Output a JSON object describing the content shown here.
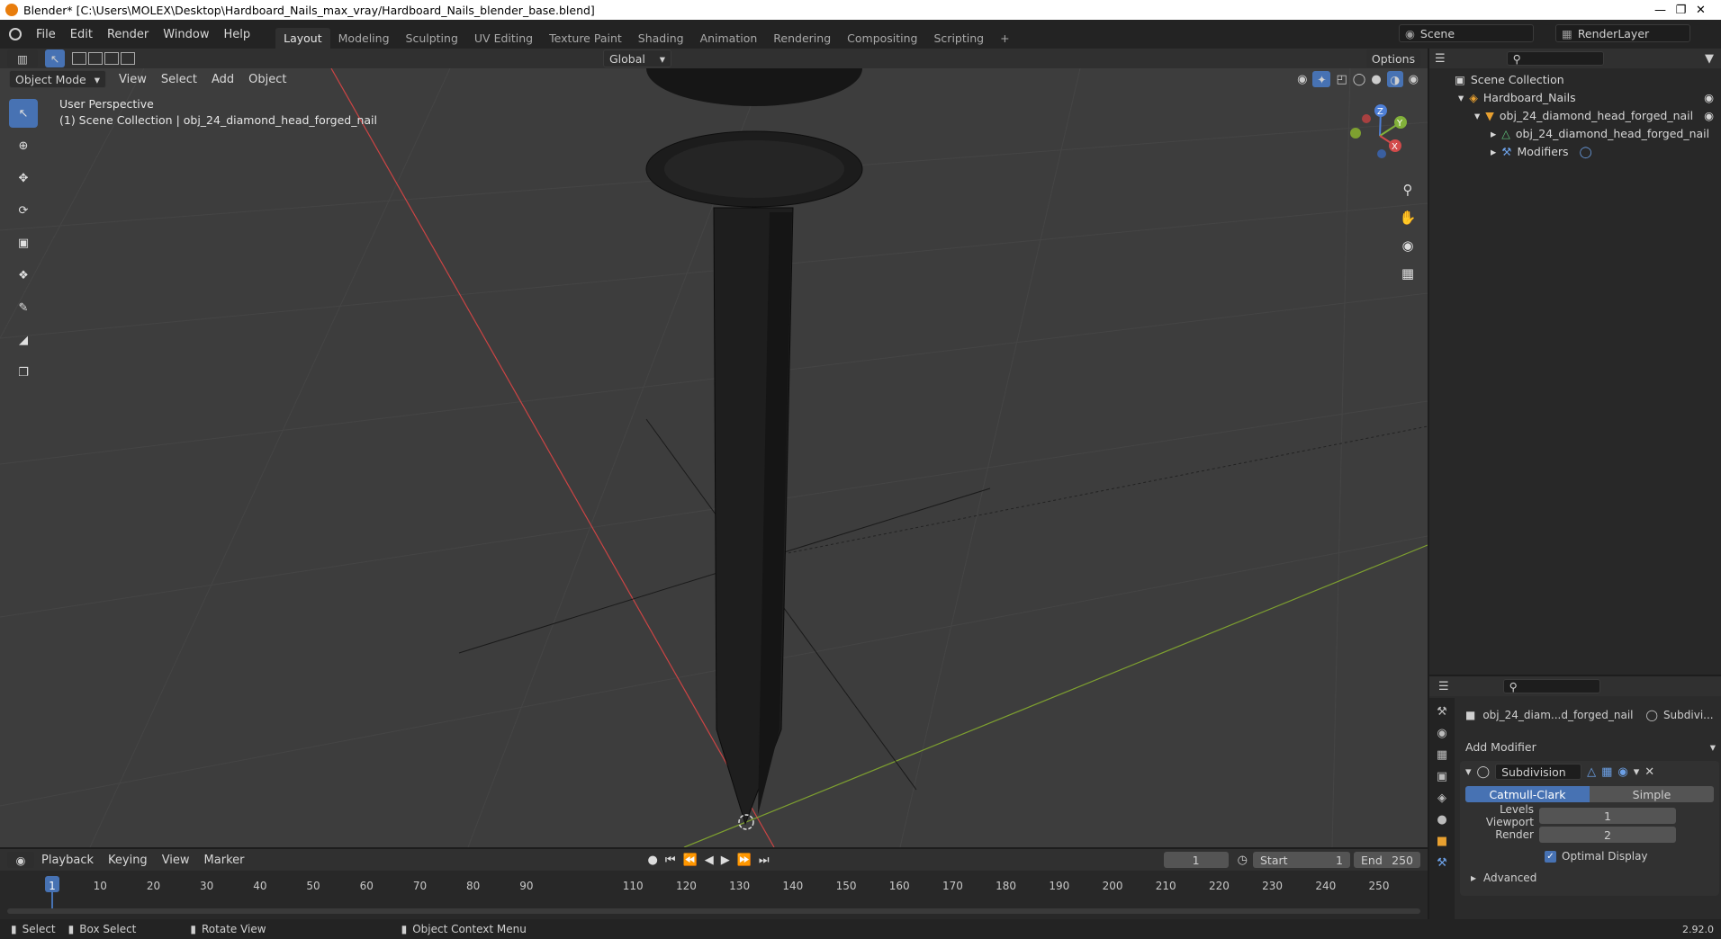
{
  "title": "Blender* [C:\\Users\\MOLEX\\Desktop\\Hardboard_Nails_max_vray/Hardboard_Nails_blender_base.blend]",
  "menus": [
    "File",
    "Edit",
    "Render",
    "Window",
    "Help"
  ],
  "workspaces": [
    "Layout",
    "Modeling",
    "Sculpting",
    "UV Editing",
    "Texture Paint",
    "Shading",
    "Animation",
    "Rendering",
    "Compositing",
    "Scripting"
  ],
  "scene": "Scene",
  "render_layer": "RenderLayer",
  "viewport": {
    "mode": "Object Mode",
    "menus": [
      "View",
      "Select",
      "Add",
      "Object"
    ],
    "transform": "Global",
    "options": "Options",
    "perspective": "User Perspective",
    "collection_info": "(1) Scene Collection | obj_24_diamond_head_forged_nail",
    "gizmo": {
      "z": "Z",
      "y": "Y",
      "x": "X"
    }
  },
  "outliner": {
    "root": "Scene Collection",
    "collection": "Hardboard_Nails",
    "object": "obj_24_diamond_head_forged_nail",
    "mesh": "obj_24_diamond_head_forged_nail",
    "modifiers": "Modifiers"
  },
  "properties": {
    "object": "obj_24_diam...d_forged_nail",
    "modifier_tab": "Subdivi...",
    "add_modifier": "Add Modifier",
    "modifier_name": "Subdivision",
    "algo_a": "Catmull-Clark",
    "algo_b": "Simple",
    "levels_label": "Levels Viewport",
    "levels_value": "1",
    "render_label": "Render",
    "render_value": "2",
    "optimal": "Optimal Display",
    "advanced": "Advanced"
  },
  "timeline": {
    "menus": [
      "Playback",
      "Keying",
      "View",
      "Marker"
    ],
    "current_frame": "1",
    "start_label": "Start",
    "start": "1",
    "end_label": "End",
    "end": "250",
    "ticks": [
      "1",
      "10",
      "20",
      "30",
      "40",
      "50",
      "60",
      "70",
      "80",
      "90",
      "110",
      "120",
      "130",
      "140",
      "150",
      "160",
      "170",
      "180",
      "190",
      "200",
      "210",
      "220",
      "230",
      "240",
      "250"
    ]
  },
  "status": {
    "select": "Select",
    "box_select": "Box Select",
    "rotate": "Rotate View",
    "context": "Object Context Menu",
    "version": "2.92.0"
  }
}
